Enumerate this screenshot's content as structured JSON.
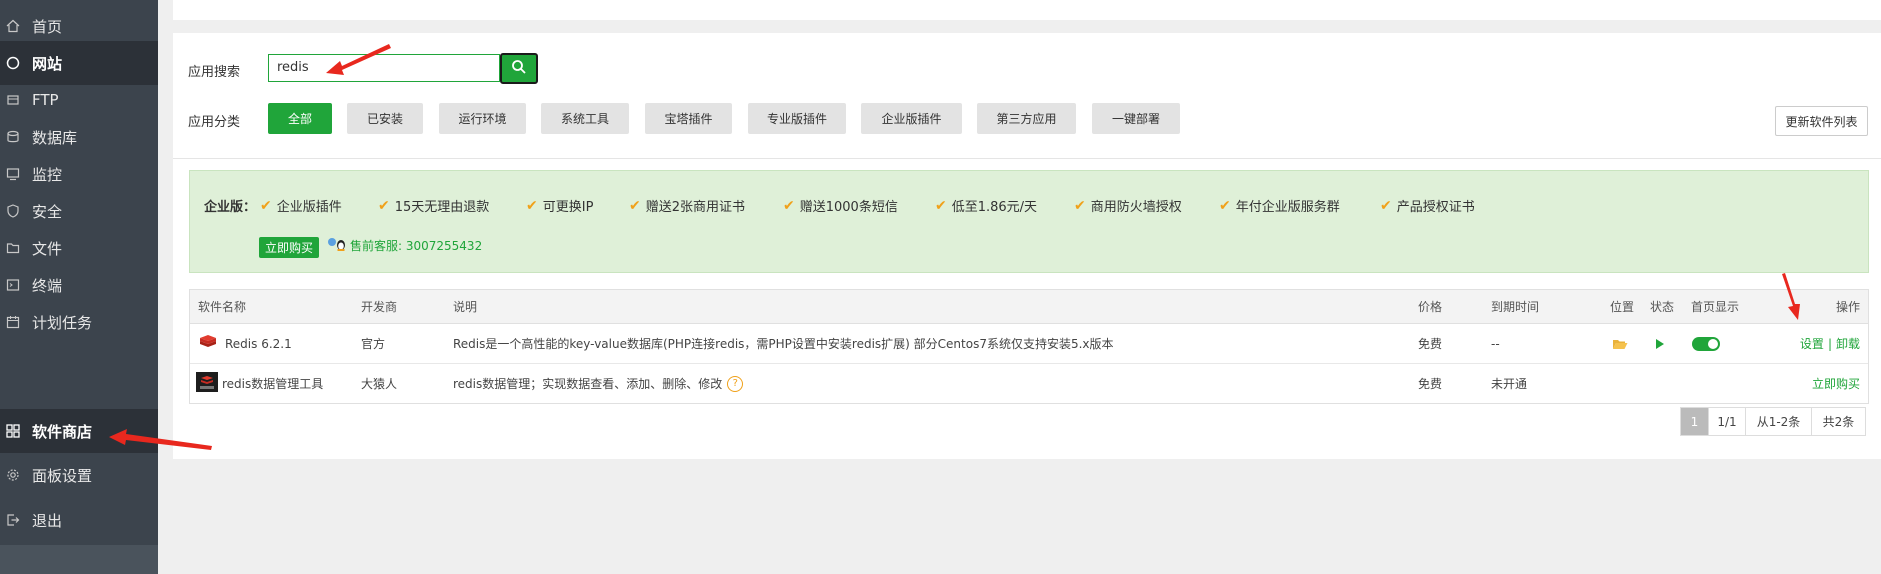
{
  "sidebar": {
    "items": [
      {
        "label": "首页",
        "icon": "home-icon"
      },
      {
        "label": "网站",
        "icon": "globe-icon"
      },
      {
        "label": "FTP",
        "icon": "ftp-icon"
      },
      {
        "label": "数据库",
        "icon": "database-icon"
      },
      {
        "label": "监控",
        "icon": "monitor-icon"
      },
      {
        "label": "安全",
        "icon": "shield-icon"
      },
      {
        "label": "文件",
        "icon": "folder-icon"
      },
      {
        "label": "终端",
        "icon": "terminal-icon"
      },
      {
        "label": "计划任务",
        "icon": "calendar-icon"
      },
      {
        "label": "软件商店",
        "icon": "grid-icon"
      },
      {
        "label": "面板设置",
        "icon": "gear-icon"
      },
      {
        "label": "退出",
        "icon": "logout-icon"
      }
    ]
  },
  "search": {
    "label": "应用搜索",
    "value": "redis"
  },
  "categories": {
    "label": "应用分类",
    "items": [
      "全部",
      "已安装",
      "运行环境",
      "系统工具",
      "宝塔插件",
      "专业版插件",
      "企业版插件",
      "第三方应用",
      "一键部署"
    ],
    "selected": "全部"
  },
  "refresh_label": "更新软件列表",
  "promo": {
    "title": "企业版：",
    "features": [
      "企业版插件",
      "15天无理由退款",
      "可更换IP",
      "赠送2张商用证书",
      "赠送1000条短信",
      "低至1.86元/天",
      "商用防火墙授权",
      "年付企业版服务群",
      "产品授权证书"
    ],
    "buy_label": "立即购买",
    "support": "售前客服: 3007255432"
  },
  "table": {
    "headers": {
      "name": "软件名称",
      "dev": "开发商",
      "desc": "说明",
      "price": "价格",
      "expire": "到期时间",
      "location": "位置",
      "status": "状态",
      "home": "首页显示",
      "action": "操作"
    },
    "rows": [
      {
        "name": "Redis 6.2.1",
        "dev": "官方",
        "desc": "Redis是一个高性能的key-value数据库(PHP连接redis，需PHP设置中安装redis扩展) 部分Centos7系统仅支持安装5.x版本",
        "price": "免费",
        "expire": "--",
        "action_set": "设置",
        "sep": "|",
        "action_uninstall": "卸载"
      },
      {
        "name": "redis数据管理工具",
        "dev": "大猿人",
        "desc": "redis数据管理；实现数据查看、添加、删除、修改",
        "price": "免费",
        "expire": "未开通",
        "action": "立即购买"
      }
    ]
  },
  "pagination": {
    "current": "1",
    "pages": "1/1",
    "range": "从1-2条",
    "total": "共2条"
  },
  "colors": {
    "accent": "#20a53a",
    "sidebar": "#3c444d",
    "annotation": "#e8281e"
  }
}
